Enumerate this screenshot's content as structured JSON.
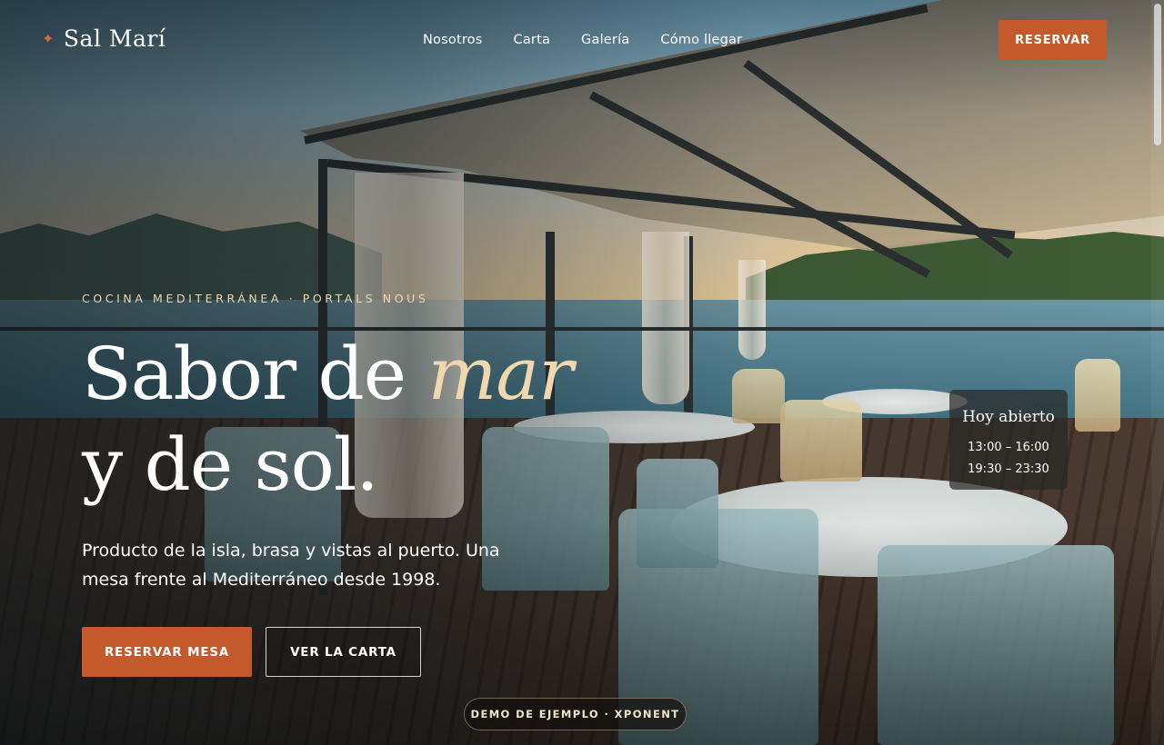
{
  "brand": {
    "name": "Sal Marí",
    "icon": "sparkle-icon",
    "accent_color": "#c45a2c"
  },
  "nav": {
    "items": [
      {
        "label": "Nosotros"
      },
      {
        "label": "Carta"
      },
      {
        "label": "Galería"
      },
      {
        "label": "Cómo llegar"
      }
    ],
    "reserve_label": "RESERVAR"
  },
  "hero": {
    "eyebrow": "COCINA MEDITERRÁNEA · PORTALS NOUS",
    "title_part1": "Sabor de ",
    "title_accent": "mar",
    "title_line2": "y de sol.",
    "lead": "Producto de la isla, brasa y vistas al puerto. Una mesa frente al Mediterráneo desde 1998.",
    "primary_cta": "RESERVAR MESA",
    "secondary_cta": "VER LA CARTA"
  },
  "hours": {
    "title": "Hoy abierto",
    "slots": [
      "13:00 – 16:00",
      "19:30 – 23:30"
    ]
  },
  "badge": {
    "label": "DEMO DE EJEMPLO · XPONENT"
  }
}
